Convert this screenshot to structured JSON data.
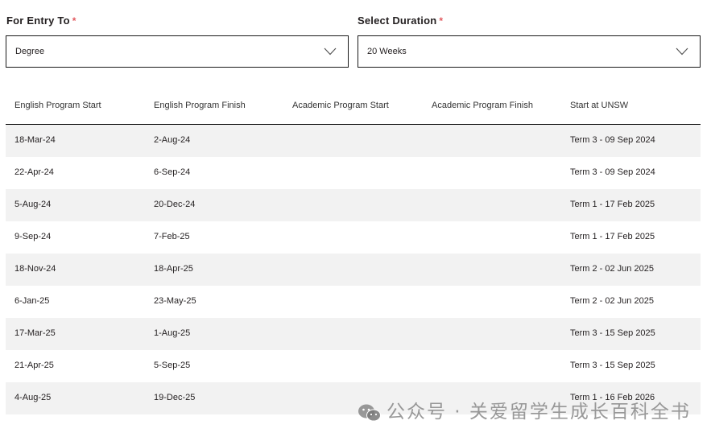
{
  "form": {
    "entry": {
      "label": "For Entry To",
      "required_mark": "*",
      "value": "Degree"
    },
    "duration": {
      "label": "Select Duration",
      "required_mark": "*",
      "value": "20 Weeks"
    }
  },
  "table": {
    "headers": [
      "English Program Start",
      "English Program Finish",
      "Academic Program Start",
      "Academic Program Finish",
      "Start at UNSW"
    ],
    "rows": [
      [
        "18-Mar-24",
        "2-Aug-24",
        "",
        "",
        "Term 3 - 09 Sep 2024"
      ],
      [
        "22-Apr-24",
        "6-Sep-24",
        "",
        "",
        "Term 3 - 09 Sep 2024"
      ],
      [
        "5-Aug-24",
        "20-Dec-24",
        "",
        "",
        "Term 1 - 17 Feb 2025"
      ],
      [
        "9-Sep-24",
        "7-Feb-25",
        "",
        "",
        "Term 1 - 17 Feb 2025"
      ],
      [
        "18-Nov-24",
        "18-Apr-25",
        "",
        "",
        "Term 2 - 02 Jun 2025"
      ],
      [
        "6-Jan-25",
        "23-May-25",
        "",
        "",
        "Term 2 - 02 Jun 2025"
      ],
      [
        "17-Mar-25",
        "1-Aug-25",
        "",
        "",
        "Term 3 - 15 Sep 2025"
      ],
      [
        "21-Apr-25",
        "5-Sep-25",
        "",
        "",
        "Term 3 - 15 Sep 2025"
      ],
      [
        "4-Aug-25",
        "19-Dec-25",
        "",
        "",
        "Term 1 - 16 Feb 2026"
      ]
    ]
  },
  "watermark": {
    "icon": "wechat-icon",
    "text": "公众号 · 关爱留学生成长百科全书"
  },
  "colors": {
    "required": "#e2595e",
    "row_shade": "#f2f2f2",
    "border": "#1a1a1a"
  }
}
